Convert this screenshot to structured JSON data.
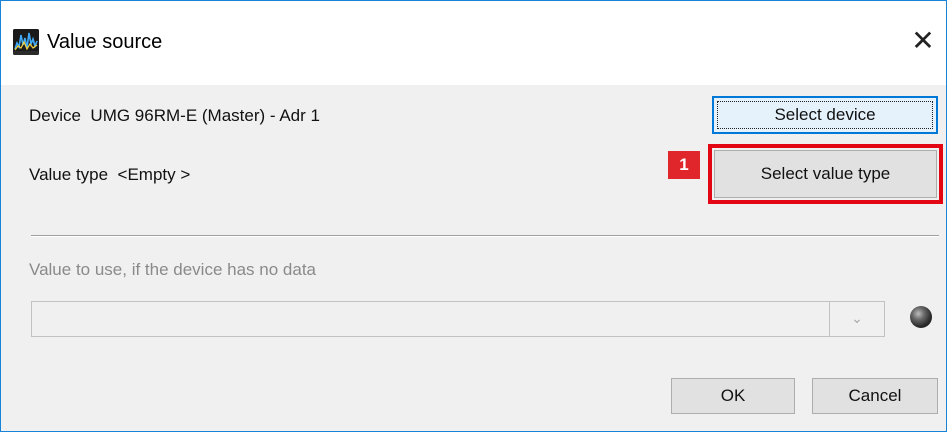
{
  "window": {
    "title": "Value source",
    "close_glyph": "✕"
  },
  "device": {
    "label": "Device",
    "value": "UMG 96RM-E (Master) - Adr 1",
    "select_button": "Select device"
  },
  "value_type": {
    "label": "Value type",
    "value": "<Empty >",
    "select_button": "Select value type",
    "callout_number": "1"
  },
  "fallback": {
    "label": "Value to use, if the device has no data",
    "combo_value": "",
    "combo_arrow": "⌄",
    "led_state": "off"
  },
  "footer": {
    "ok_button": "OK",
    "cancel_button": "Cancel"
  },
  "colors": {
    "highlight": "#e30613",
    "callout": "#e0262b",
    "window_border": "#1883d7"
  }
}
